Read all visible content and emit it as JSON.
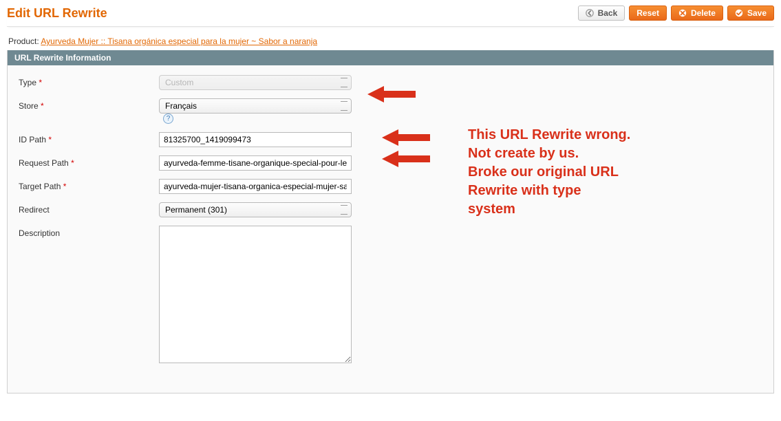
{
  "header": {
    "page_title": "Edit URL Rewrite",
    "buttons": {
      "back": "Back",
      "reset": "Reset",
      "delete": "Delete",
      "save": "Save"
    }
  },
  "product": {
    "label": "Product:",
    "link_text": "Ayurveda Mujer :: Tisana orgánica especial para la mujer ~ Sabor a naranja"
  },
  "panel": {
    "title": "URL Rewrite Information"
  },
  "form": {
    "type": {
      "label": "Type",
      "required": "*",
      "value": "Custom"
    },
    "store": {
      "label": "Store",
      "required": "*",
      "value": "Français"
    },
    "id_path": {
      "label": "ID Path",
      "required": "*",
      "value": "81325700_1419099473"
    },
    "request_path": {
      "label": "Request Path",
      "required": "*",
      "value": "ayurveda-femme-tisane-organique-special-pour-les-"
    },
    "target_path": {
      "label": "Target Path",
      "required": "*",
      "value": "ayurveda-mujer-tisana-organica-especial-mujer-sab"
    },
    "redirect": {
      "label": "Redirect",
      "value": "Permanent (301)"
    },
    "description": {
      "label": "Description",
      "value": ""
    }
  },
  "annotation": {
    "text": "This URL Rewrite wrong.\nNot create by us.\nBroke our original URL\nRewrite with type\nsystem"
  }
}
